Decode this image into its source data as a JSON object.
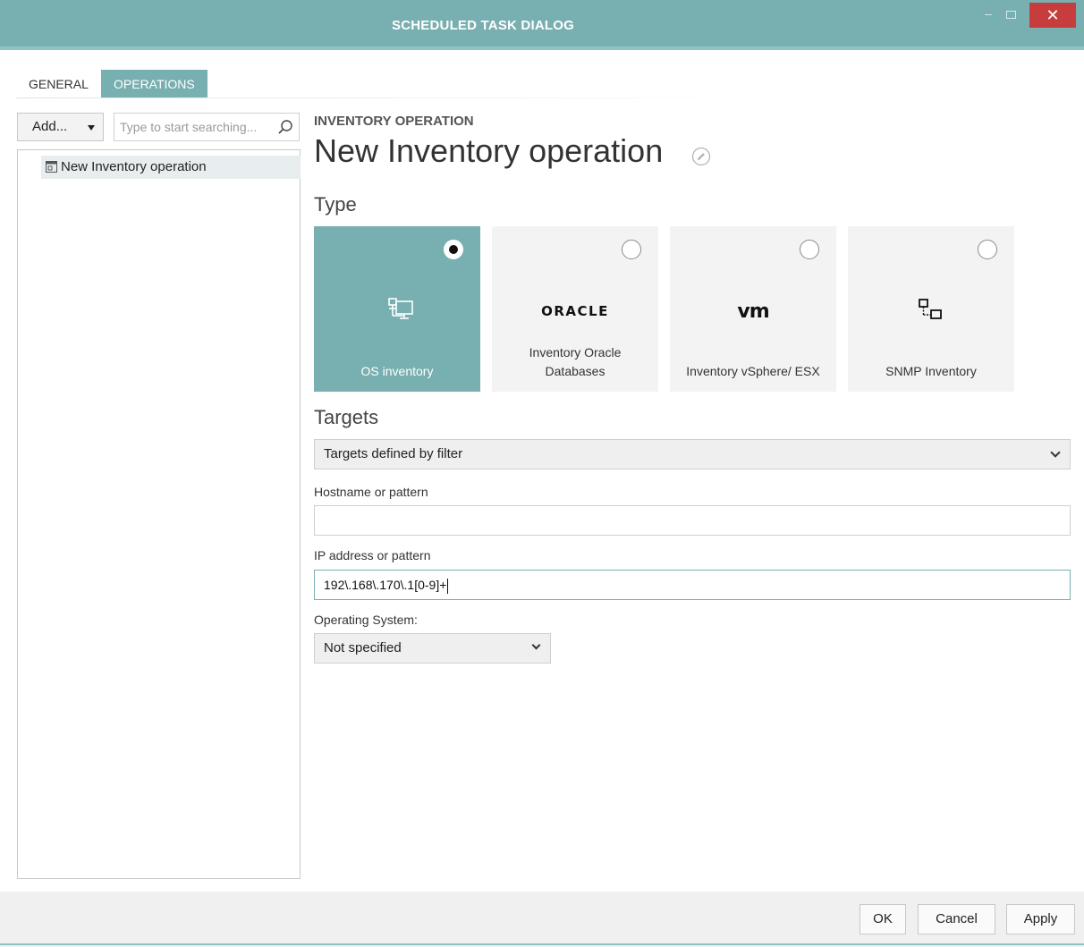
{
  "window": {
    "title": "SCHEDULED TASK DIALOG",
    "minimize_glyph": "–",
    "close_glyph": "✕"
  },
  "tabs": [
    {
      "label": "GENERAL",
      "active": false
    },
    {
      "label": "OPERATIONS",
      "active": true
    }
  ],
  "left_pane": {
    "add_label": "Add...",
    "search_placeholder": "Type to start searching...",
    "tree_items": [
      {
        "label": "New Inventory operation",
        "icon": "operation-icon",
        "selected": true
      }
    ]
  },
  "operation": {
    "kicker": "INVENTORY OPERATION",
    "name": "New Inventory operation"
  },
  "type_section": {
    "title": "Type",
    "options": [
      {
        "label": "OS inventory",
        "icon": "computer-network-icon",
        "selected": true
      },
      {
        "label": "Inventory Oracle Databases",
        "icon_text": "ORACLE",
        "selected": false
      },
      {
        "label": "Inventory vSphere/ ESX",
        "icon_text": "vm",
        "selected": false
      },
      {
        "label": "SNMP Inventory",
        "icon": "snmp-icon",
        "selected": false
      }
    ]
  },
  "targets_section": {
    "title": "Targets",
    "mode_selected": "Targets defined by filter",
    "hostname_label": "Hostname or pattern",
    "hostname_value": "",
    "ip_label": "IP address or pattern",
    "ip_value": "192\\.168\\.170\\.1[0-9]+",
    "os_label": "Operating System:",
    "os_selected": "Not specified"
  },
  "footer": {
    "ok_label": "OK",
    "cancel_label": "Cancel",
    "apply_label": "Apply"
  },
  "colors": {
    "accent": "#78afb0",
    "close_button": "#c73d3d",
    "card_bg": "#f3f3f3"
  }
}
